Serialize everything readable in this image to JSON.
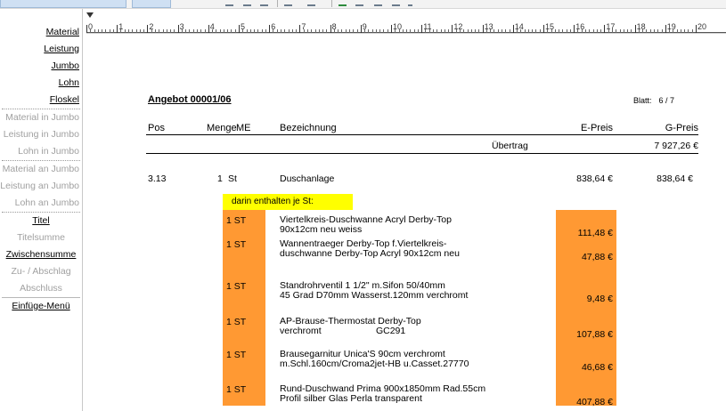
{
  "sidebar": {
    "items": [
      {
        "label": "Material",
        "state": "enabled"
      },
      {
        "label": "Leistung",
        "state": "enabled"
      },
      {
        "label": "Jumbo",
        "state": "enabled"
      },
      {
        "label": "Lohn",
        "state": "enabled"
      },
      {
        "label": "Floskel",
        "state": "enabled"
      },
      {
        "label": "Material in Jumbo",
        "state": "disabled"
      },
      {
        "label": "Leistung in Jumbo",
        "state": "disabled"
      },
      {
        "label": "Lohn in Jumbo",
        "state": "disabled"
      },
      {
        "label": "Material an Jumbo",
        "state": "disabled"
      },
      {
        "label": "Leistung an Jumbo",
        "state": "disabled"
      },
      {
        "label": "Lohn an Jumbo",
        "state": "disabled"
      },
      {
        "label": "Titel",
        "state": "enabled"
      },
      {
        "label": "Titelsumme",
        "state": "disabled"
      },
      {
        "label": "Zwischensumme",
        "state": "enabled"
      },
      {
        "label": "Zu- / Abschlag",
        "state": "disabled"
      },
      {
        "label": "Abschluss",
        "state": "disabled"
      },
      {
        "label": "Einfüge-Menü",
        "state": "enabled"
      }
    ]
  },
  "ruler": {
    "labels": [
      "0",
      "1",
      "2",
      "3",
      "4",
      "5",
      "6",
      "7",
      "8",
      "9",
      "10",
      "11",
      "12",
      "13",
      "14",
      "15",
      "16",
      "17",
      "18",
      "19",
      "20"
    ]
  },
  "document": {
    "title": "Angebot 00001/06",
    "sheet_label": "Blatt:",
    "sheet_value": "6 / 7",
    "columns": {
      "pos": "Pos",
      "menge": "Menge",
      "me": "ME",
      "bezeichnung": "Bezeichnung",
      "epreis": "E-Preis",
      "gpreis": "G-Preis"
    },
    "carry_over": {
      "label": "Übertrag",
      "value": "7 927,26 €"
    },
    "position": {
      "pos": "3.13",
      "menge": "1",
      "me": "St",
      "bezeichnung": "Duschanlage",
      "epreis": "838,64 €",
      "gpreis": "838,64 €"
    },
    "included_label": "darin enthalten je St:",
    "components": [
      {
        "qty": "1 ST",
        "line1": "Viertelkreis-Duschwanne Acryl Derby-Top",
        "line2": "90x12cm neu weiss",
        "price": "111,48 €"
      },
      {
        "qty": "1 ST",
        "line1": "Wannentraeger Derby-Top f.Viertelkreis-",
        "line2": "duschwanne Derby-Top Acryl 90x12cm neu",
        "price": "47,88 €"
      },
      {
        "qty": "1 ST",
        "line1": "Standrohrventil 1 1/2\" m.Sifon 50/40mm",
        "line2": "45 Grad D70mm Wasserst.120mm verchromt",
        "price": "9,48 €"
      },
      {
        "qty": "1 ST",
        "line1": "AP-Brause-Thermostat Derby-Top",
        "line2": "verchromt                     GC291",
        "price": "107,88 €"
      },
      {
        "qty": "1 ST",
        "line1": "Brausegarnitur Unica'S 90cm verchromt",
        "line2": "m.Schl.160cm/Croma2jet-HB u.Casset.27770",
        "price": "46,68 €"
      },
      {
        "qty": "1 ST",
        "line1": "Rund-Duschwand Prima 900x1850mm Rad.55cm",
        "line2": "Profil silber Glas Perla transparent",
        "price": "407,88 €"
      }
    ]
  },
  "colors": {
    "highlight_yellow": "#ffff00",
    "highlight_orange": "#ff9933",
    "disabled_text": "#a0a0a0"
  }
}
